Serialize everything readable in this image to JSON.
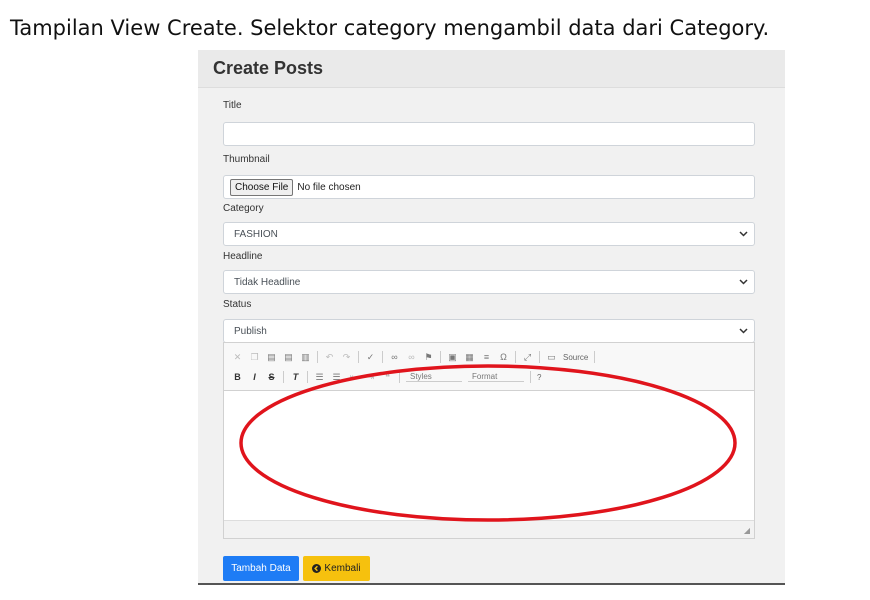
{
  "caption": "Tampilan View Create. Selektor category mengambil data dari Category.",
  "card": {
    "title": "Create Posts"
  },
  "form": {
    "title_label": "Title",
    "title_value": "",
    "thumbnail_label": "Thumbnail",
    "file_button": "Choose File",
    "file_status": "No file chosen",
    "category_label": "Category",
    "category_value": "FASHION",
    "headline_label": "Headline",
    "headline_value": "Tidak Headline",
    "status_label": "Status",
    "status_value": "Publish"
  },
  "editor": {
    "source_label": "Source",
    "styles_label": "Styles",
    "format_label": "Format",
    "help_label": "?"
  },
  "buttons": {
    "submit": "Tambah Data",
    "back": "Kembali"
  },
  "colors": {
    "primary": "#1e7cf5",
    "warning": "#f6c10e",
    "annotation": "#e0141c"
  },
  "icons": {
    "back": "arrow-left-circle-icon",
    "dropdown": "chevron-down-icon"
  }
}
